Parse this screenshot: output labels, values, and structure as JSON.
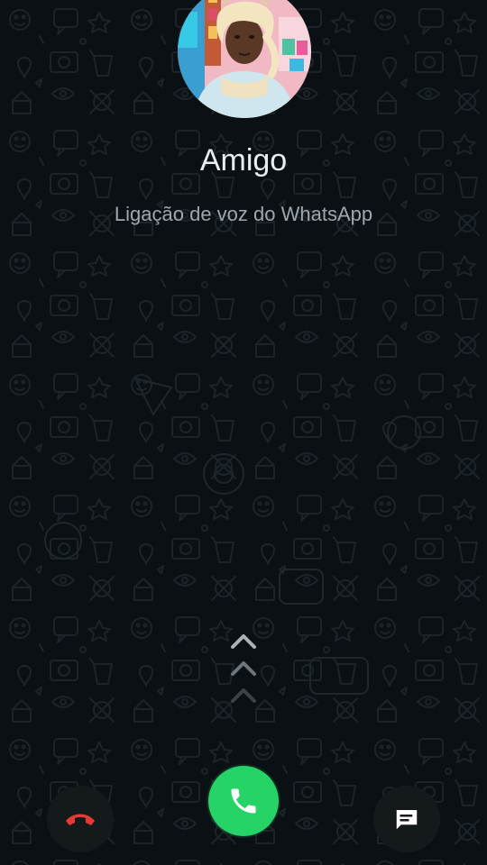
{
  "call": {
    "caller_name": "Amigo",
    "call_type": "Ligação de voz do WhatsApp"
  },
  "controls": {
    "decline_icon": "phone-hangup-icon",
    "accept_icon": "phone-icon",
    "message_icon": "message-icon",
    "swipe_icon": "chevron-up-icon"
  },
  "colors": {
    "background": "#0b1014",
    "accept": "#25d366",
    "decline": "#e53935",
    "name_text": "#e9edef",
    "subtitle_text": "#9ea7ad"
  }
}
